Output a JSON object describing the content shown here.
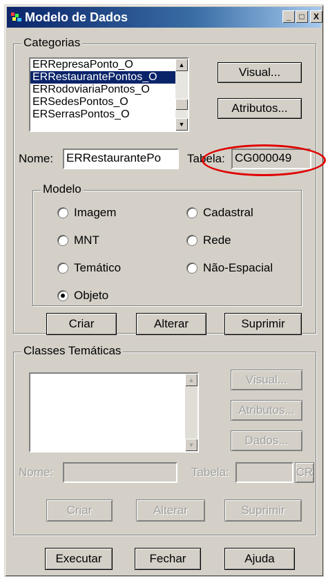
{
  "window": {
    "title": "Modelo de Dados",
    "min_glyph": "_",
    "max_glyph": "□",
    "close_glyph": "X"
  },
  "categorias": {
    "legend": "Categorias",
    "items": [
      "ERRepresaPonto_O",
      "ERRestaurantePontos_O",
      "ERRodoviariaPontos_O",
      "ERSedesPontos_O",
      "ERSerrasPontos_O"
    ],
    "selected_index": 1,
    "visual_button": "Visual...",
    "atributos_button": "Atributos...",
    "nome_label": "Nome:",
    "nome_value": "ERRestaurantePo",
    "tabela_label": "Tabela:",
    "tabela_value": "CG000049"
  },
  "modelo": {
    "legend": "Modelo",
    "options": [
      {
        "label": "Imagem",
        "checked": false
      },
      {
        "label": "Cadastral",
        "checked": false
      },
      {
        "label": "MNT",
        "checked": false
      },
      {
        "label": "Rede",
        "checked": false
      },
      {
        "label": "Temático",
        "checked": false
      },
      {
        "label": "Não-Espacial",
        "checked": false
      },
      {
        "label": "Objeto",
        "checked": true
      }
    ]
  },
  "categoria_actions": {
    "criar": "Criar",
    "alterar": "Alterar",
    "suprimir": "Suprimir"
  },
  "classes": {
    "legend": "Classes Temáticas",
    "visual_button": "Visual...",
    "atributos_button": "Atributos...",
    "dados_button": "Dados...",
    "nome_label": "Nome:",
    "nome_value": "",
    "tabela_label": "Tabela:",
    "tabela_value": "",
    "cr_button": "CR",
    "criar": "Criar",
    "alterar": "Alterar",
    "suprimir": "Suprimir"
  },
  "footer": {
    "executar": "Executar",
    "fechar": "Fechar",
    "ajuda": "Ajuda"
  },
  "colors": {
    "accent": "#0a246a",
    "highlight": "#e00000",
    "face": "#d4d0c8"
  }
}
